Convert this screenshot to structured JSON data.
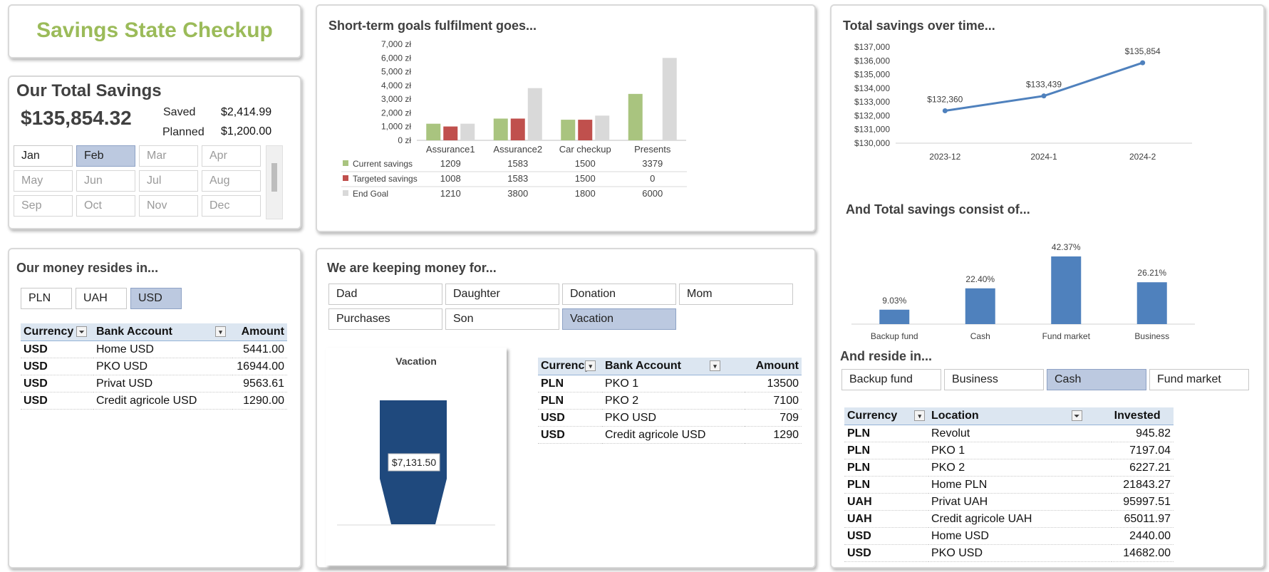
{
  "title": "Savings State Checkup",
  "total": {
    "heading": "Our Total Savings",
    "amount": "$135,854.32",
    "saved_label": "Saved",
    "saved_value": "$2,414.99",
    "planned_label": "Planned",
    "planned_value": "$1,200.00"
  },
  "months": [
    {
      "label": "Jan",
      "state": "normal"
    },
    {
      "label": "Feb",
      "state": "selected"
    },
    {
      "label": "Mar",
      "state": "dim"
    },
    {
      "label": "Apr",
      "state": "dim"
    },
    {
      "label": "May",
      "state": "dim"
    },
    {
      "label": "Jun",
      "state": "dim"
    },
    {
      "label": "Jul",
      "state": "dim"
    },
    {
      "label": "Aug",
      "state": "dim"
    },
    {
      "label": "Sep",
      "state": "dim"
    },
    {
      "label": "Oct",
      "state": "dim"
    },
    {
      "label": "Nov",
      "state": "dim"
    },
    {
      "label": "Dec",
      "state": "dim"
    }
  ],
  "resides": {
    "title": "Our money resides in...",
    "currencies": [
      {
        "label": "PLN",
        "selected": false
      },
      {
        "label": "UAH",
        "selected": false
      },
      {
        "label": "USD",
        "selected": true
      }
    ],
    "headers": [
      "Currency",
      "Bank Account",
      "Amount"
    ],
    "rows": [
      [
        "USD",
        "Home USD",
        "5441.00"
      ],
      [
        "USD",
        "PKO USD",
        "16944.00"
      ],
      [
        "USD",
        "Privat USD",
        "9563.61"
      ],
      [
        "USD",
        "Credit agricole USD",
        "1290.00"
      ]
    ]
  },
  "keeping": {
    "title": "We are keeping money for...",
    "purposes": [
      {
        "label": "Dad",
        "selected": false
      },
      {
        "label": "Daughter",
        "selected": false
      },
      {
        "label": "Donation",
        "selected": false
      },
      {
        "label": "Mom",
        "selected": false
      },
      {
        "label": "Purchases",
        "selected": false
      },
      {
        "label": "Son",
        "selected": false
      },
      {
        "label": "Vacation",
        "selected": true
      }
    ],
    "headers": [
      "Currency",
      "Bank Account",
      "Amount"
    ],
    "rows": [
      [
        "PLN",
        "PKO 1",
        "13500"
      ],
      [
        "PLN",
        "PKO 2",
        "7100"
      ],
      [
        "USD",
        "PKO USD",
        "709"
      ],
      [
        "USD",
        "Credit agricole USD",
        "1290"
      ]
    ]
  },
  "reside2": {
    "title": "And reside in...",
    "types": [
      {
        "label": "Backup fund",
        "selected": false
      },
      {
        "label": "Business",
        "selected": false
      },
      {
        "label": "Cash",
        "selected": true
      },
      {
        "label": "Fund market",
        "selected": false
      }
    ],
    "headers": [
      "Currency",
      "Location",
      "Invested"
    ],
    "rows": [
      [
        "PLN",
        "Revolut",
        "945.82"
      ],
      [
        "PLN",
        "PKO 1",
        "7197.04"
      ],
      [
        "PLN",
        "PKO 2",
        "6227.21"
      ],
      [
        "PLN",
        "Home PLN",
        "21843.27"
      ],
      [
        "UAH",
        "Privat UAH",
        "95997.51"
      ],
      [
        "UAH",
        "Credit agricole UAH",
        "65011.97"
      ],
      [
        "USD",
        "Home USD",
        "2440.00"
      ],
      [
        "USD",
        "PKO USD",
        "14682.00"
      ]
    ]
  },
  "chart_data": [
    {
      "type": "bar",
      "title": "Short-term goals fulfilment goes...",
      "categories": [
        "Assurance1",
        "Assurance2",
        "Car checkup",
        "Presents"
      ],
      "series": [
        {
          "name": "Current savings",
          "color": "#a9c47f",
          "values": [
            1209,
            1583,
            1500,
            3379
          ]
        },
        {
          "name": "Targeted savings",
          "color": "#c0504d",
          "values": [
            1008,
            1583,
            1500,
            0
          ]
        },
        {
          "name": "End Goal",
          "color": "#d9d9d9",
          "values": [
            1210,
            3800,
            1800,
            6000
          ]
        }
      ],
      "ylim": [
        0,
        7000
      ],
      "yticks": [
        "0 zł",
        "1,000 zł",
        "2,000 zł",
        "3,000 zł",
        "4,000 zł",
        "5,000 zł",
        "6,000 zł",
        "7,000 zł"
      ],
      "legend": "data-table-below"
    },
    {
      "type": "line",
      "title": "Total savings over time...",
      "x": [
        "2023-12",
        "2024-1",
        "2024-2"
      ],
      "values": [
        132360,
        133439,
        135854
      ],
      "labels": [
        "$132,360",
        "$133,439",
        "$135,854"
      ],
      "ylim": [
        130000,
        137000
      ],
      "yticks": [
        "$130,000",
        "$131,000",
        "$132,000",
        "$133,000",
        "$134,000",
        "$135,000",
        "$136,000",
        "$137,000"
      ],
      "color": "#4f81bd"
    },
    {
      "type": "bar",
      "title": "And Total savings consist of...",
      "categories": [
        "Backup fund",
        "Cash",
        "Fund market",
        "Business"
      ],
      "values": [
        9.03,
        22.4,
        42.37,
        26.21
      ],
      "labels": [
        "9.03%",
        "22.40%",
        "42.37%",
        "26.21%"
      ],
      "color": "#4f81bd"
    },
    {
      "type": "area",
      "title": "Vacation",
      "label": "$7,131.50",
      "color": "#1f497d"
    }
  ]
}
